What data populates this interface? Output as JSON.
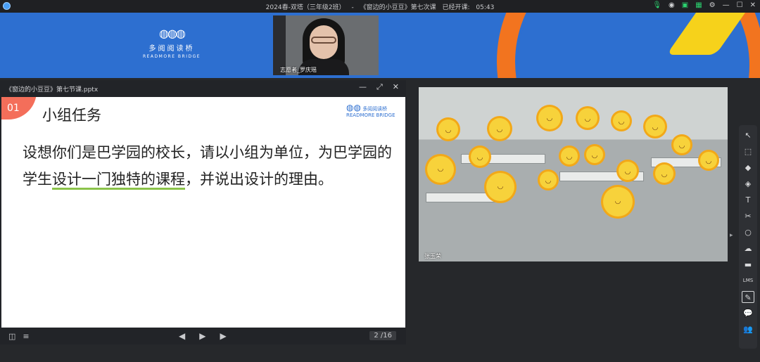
{
  "topbar": {
    "title_class": "2024春-双塔（三年级2班）",
    "title_sep": "-",
    "title_lesson": "《窗边的小豆豆》第七次课",
    "elapsed_label": "已经开课:",
    "elapsed_time": "05:43"
  },
  "banner": {
    "logo_cn": "多阅阅读桥",
    "logo_en": "READMORE BRIDGE"
  },
  "teacher_video": {
    "label": "志愿者_罗庆瑶"
  },
  "ppt": {
    "filename": "《窗边的小豆豆》第七节课.pptx",
    "slide": {
      "number": "01",
      "title": "小组任务",
      "logo_cn": "多阅阅读桥",
      "logo_en": "READMORE BRIDGE",
      "body_part1": "设想你们是巴学园的校长，请以小组为单位，为巴学园的学生",
      "body_highlight": "设计一门独特的课程",
      "body_part2": "，并说出设计的理由。"
    },
    "page": "2 /16"
  },
  "class_video": {
    "label": "张玉荣"
  },
  "toolbar": {
    "items": [
      "select-tool",
      "area-select-tool",
      "highlight-tool",
      "eraser-tool",
      "text-tool",
      "scissors-tool",
      "circle-tool",
      "cloud-tool",
      "briefcase-tool",
      "lms-tool",
      "edit-tool",
      "chat-tool",
      "users-tool"
    ],
    "lms_label": "LMS"
  }
}
